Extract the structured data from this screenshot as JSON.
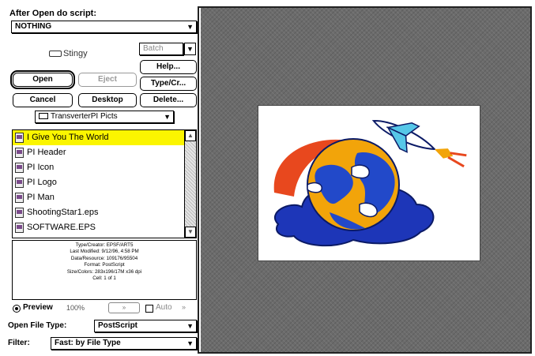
{
  "after_open": {
    "label": "After Open do script:",
    "value": "NOTHING"
  },
  "volume": {
    "name": "Stingy",
    "popup": "Batch"
  },
  "buttons": {
    "open": "Open",
    "eject": "Eject",
    "help": "Help...",
    "type_creator": "Type/Cr...",
    "cancel": "Cancel",
    "desktop": "Desktop",
    "delete": "Delete..."
  },
  "folder": {
    "name": "TransverterPI Picts"
  },
  "files": [
    {
      "name": "I Give You The World",
      "selected": true
    },
    {
      "name": "PI Header",
      "selected": false
    },
    {
      "name": "PI Icon",
      "selected": false
    },
    {
      "name": "PI Logo",
      "selected": false
    },
    {
      "name": "PI Man",
      "selected": false
    },
    {
      "name": "ShootingStar1.eps",
      "selected": false
    },
    {
      "name": "SOFTWARE.EPS",
      "selected": false
    }
  ],
  "info": {
    "type_creator": "Type/Creator: EPSF/ART5",
    "last_modified": "Last Modified: 9/12/96, 4:58 PM",
    "data_resource": "Data/Resource: 109176/95504",
    "format": "Format: PostScript",
    "size_colors": "Size/Colors: 283x196/17M x36 dpi",
    "cell": "Cell: 1 of 1"
  },
  "preview_controls": {
    "preview_label": "Preview",
    "zoom": "100%",
    "auto_label": "Auto"
  },
  "open_file_type": {
    "label": "Open File Type:",
    "value": "PostScript"
  },
  "filter": {
    "label": "Filter:",
    "value": "Fast: by File Type"
  },
  "colors": {
    "selection": "#fbf500",
    "preview_background": "#6b6b6b"
  }
}
